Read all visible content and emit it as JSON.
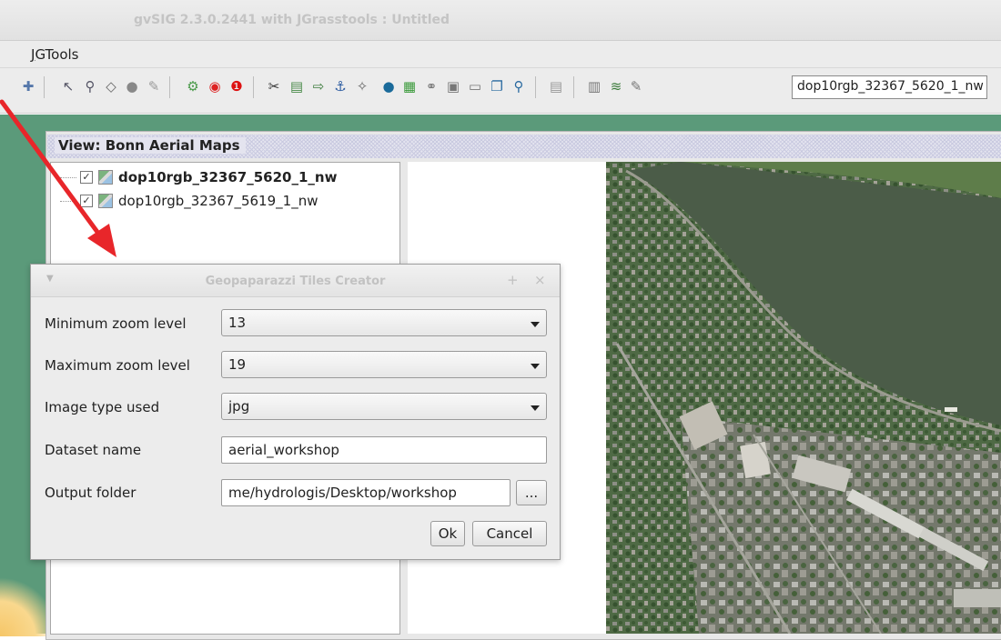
{
  "window": {
    "title": "gvSIG 2.3.0.2441 with JGrasstools : Untitled"
  },
  "menubar": {
    "items": [
      {
        "label_underlined": "J",
        "label_rest": "GTools"
      }
    ]
  },
  "toolbar": {
    "icons": [
      "layer-add-icon",
      "select-pointer-icon",
      "zoom-select-icon",
      "vertex-icon",
      "sphere-icon",
      "brush-icon",
      "gear-icon",
      "target-icon",
      "warning-icon",
      "tools-icon",
      "layers-icon",
      "export-icon",
      "anchor-icon",
      "network-icon",
      "globe-icon",
      "map-icon",
      "link-icon",
      "database-icon",
      "image-icon",
      "copy-icon",
      "magnifier-icon",
      "page-icon",
      "clipboard-icon",
      "layer-edit-icon",
      "edit-icon"
    ],
    "active_layer": "dop10rgb_32367_5620_1_nw"
  },
  "view": {
    "title": "View: Bonn Aerial Maps",
    "layers": [
      {
        "name": "dop10rgb_32367_5620_1_nw",
        "checked": true,
        "active": true
      },
      {
        "name": "dop10rgb_32367_5619_1_nw",
        "checked": true,
        "active": false
      }
    ]
  },
  "dialog": {
    "title": "Geopaparazzi Tiles Creator",
    "controls": {
      "plus": "+",
      "close": "×"
    },
    "fields": {
      "min_zoom": {
        "label": "Minimum zoom level",
        "value": "13"
      },
      "max_zoom": {
        "label": "Maximum zoom level",
        "value": "19"
      },
      "image_type": {
        "label": "Image type used",
        "value": "jpg"
      },
      "dataset_name": {
        "label": "Dataset name",
        "value": "aerial_workshop"
      },
      "output_folder": {
        "label": "Output folder",
        "value": "me/hydrologis/Desktop/workshop"
      }
    },
    "browse_label": "...",
    "ok_label": "Ok",
    "cancel_label": "Cancel"
  },
  "colors": {
    "annotation_arrow": "#e8262a",
    "mdi_background": "#5b9a7a",
    "river": "#4b5c48"
  }
}
